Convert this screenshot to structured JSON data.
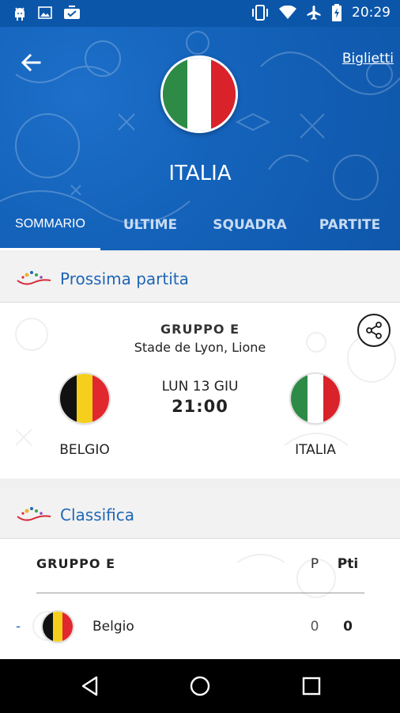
{
  "status_bar": {
    "time": "20:29"
  },
  "header": {
    "back_icon": "arrow-left-icon",
    "tickets_label": "Biglietti",
    "team_name": "ITALIA",
    "flag_colors": [
      "#2e8b45",
      "#ffffff",
      "#d9222a"
    ]
  },
  "tabs": [
    {
      "label": "SOMMARIO",
      "active": true
    },
    {
      "label": "ULTIME",
      "active": false
    },
    {
      "label": "SQUADRA",
      "active": false
    },
    {
      "label": "PARTITE",
      "active": false
    }
  ],
  "next_match": {
    "section_title": "Prossima partita",
    "group": "GRUPPO E",
    "venue": "Stade de Lyon, Lione",
    "date": "LUN 13 GIU",
    "time": "21:00",
    "home": {
      "name": "BELGIO",
      "flag_colors": [
        "#111111",
        "#f5cf1c",
        "#e2282f"
      ]
    },
    "away": {
      "name": "ITALIA",
      "flag_colors": [
        "#2e8b45",
        "#ffffff",
        "#d9222a"
      ]
    }
  },
  "standings": {
    "section_title": "Classifica",
    "group": "GRUPPO E",
    "col_played": "P",
    "col_points": "Pti",
    "rows": [
      {
        "position": "-",
        "team": "Belgio",
        "played": "0",
        "points": "0"
      }
    ]
  },
  "colors": {
    "header_blue": "#1463bb",
    "accent_blue": "#1f66b5"
  }
}
